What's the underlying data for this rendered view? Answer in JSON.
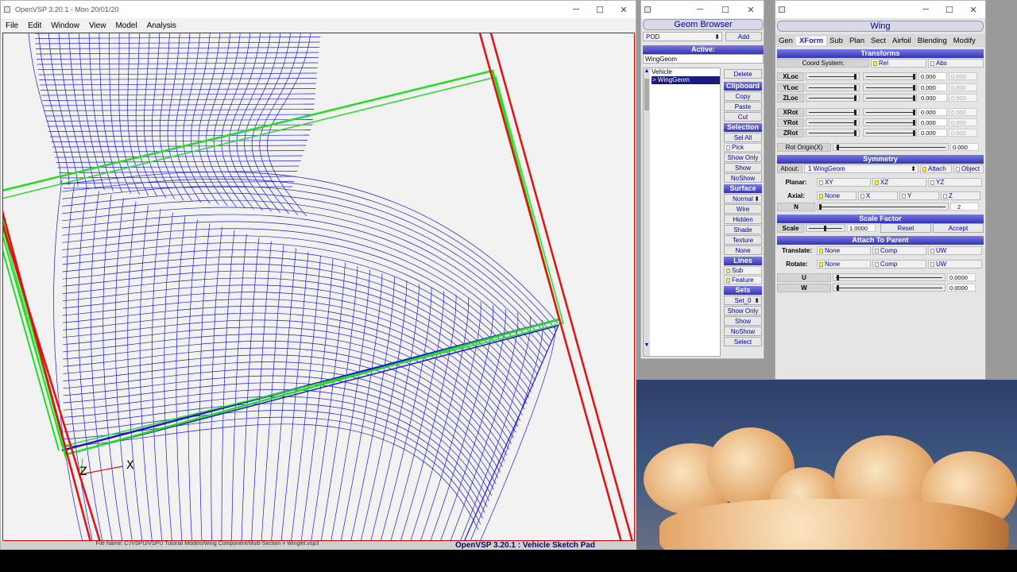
{
  "main_window": {
    "title": "OpenVSP 3.20.1 - Mon 20/01/20",
    "menu": [
      "File",
      "Edit",
      "Window",
      "View",
      "Model",
      "Analysis"
    ],
    "status_filename": "File Name: C:/VSPU/VSPU Tutorial Models/Wing Component/Multi-Section = Winglet.vsp3",
    "status_version": "OpenVSP 3.20.1 : Vehicle Sketch Pad",
    "axis_labels": {
      "z": "Z",
      "x": "X"
    },
    "colors": {
      "mesh": "#1a1ad0",
      "bbox": "#22dd22",
      "plane": "#e21010"
    }
  },
  "geom_browser": {
    "title": "Geom Browser",
    "type_select": "POD",
    "add_label": "Add",
    "active_label": "Active:",
    "active_value": "WingGeom",
    "tree": [
      "Vehicle",
      "> WingGeom"
    ],
    "delete": "Delete",
    "clipboard": {
      "header": "Clipboard",
      "items": [
        "Copy",
        "Paste",
        "Cut"
      ]
    },
    "selection": {
      "header": "Selection",
      "sel_all": "Sel All",
      "pick": "Pick",
      "items": [
        "Show Only",
        "Show",
        "NoShow"
      ]
    },
    "surface": {
      "header": "Surface",
      "select": "Normal",
      "items": [
        "Wire",
        "Hidden",
        "Shade",
        "Texture",
        "None"
      ]
    },
    "lines": {
      "header": "Lines",
      "items": [
        "Sub",
        "Feature"
      ]
    },
    "sets": {
      "header": "Sets",
      "select": "Set_0",
      "items": [
        "Show Only",
        "Show",
        "NoShow",
        "Select"
      ]
    }
  },
  "wing_panel": {
    "title": "Wing",
    "tabs": [
      "Gen",
      "XForm",
      "Sub",
      "Plan",
      "Sect",
      "Airfoil",
      "Blending",
      "Modify"
    ],
    "active_tab": "XForm",
    "transforms": {
      "header": "Transforms",
      "coord_label": "Coord System:",
      "rel": "Rel",
      "abs": "Abs",
      "rows": [
        {
          "label": "XLoc",
          "value": "0.000",
          "abs": "0.000"
        },
        {
          "label": "YLoc",
          "value": "0.000",
          "abs": "0.000"
        },
        {
          "label": "ZLoc",
          "value": "0.000",
          "abs": "0.000"
        },
        {
          "label": "XRot",
          "value": "0.000",
          "abs": "0.000"
        },
        {
          "label": "YRot",
          "value": "0.000",
          "abs": "0.000"
        },
        {
          "label": "ZRot",
          "value": "0.000",
          "abs": "0.000"
        }
      ],
      "rot_origin_label": "Rot Origin(X)",
      "rot_origin_value": "0.000"
    },
    "symmetry": {
      "header": "Symmetry",
      "about_label": "About:",
      "about_value": "1 WingGeom",
      "attach": "Attach",
      "object": "Object",
      "planar_label": "Planar:",
      "planar": [
        "XY",
        "XZ",
        "YZ"
      ],
      "axial_label": "Axial:",
      "axial": [
        "None",
        "X",
        "Y",
        "Z"
      ],
      "n_label": "N",
      "n_value": "2"
    },
    "scale": {
      "header": "Scale Factor",
      "label": "Scale",
      "value": "1.0000",
      "reset": "Reset",
      "accept": "Accept"
    },
    "attach": {
      "header": "Attach To Parent",
      "translate_label": "Translate:",
      "rotate_label": "Rotate:",
      "options": [
        "None",
        "Comp",
        "UW"
      ],
      "u_label": "U",
      "u_value": "0.0000",
      "w_label": "W",
      "w_value": "0.0000"
    }
  }
}
